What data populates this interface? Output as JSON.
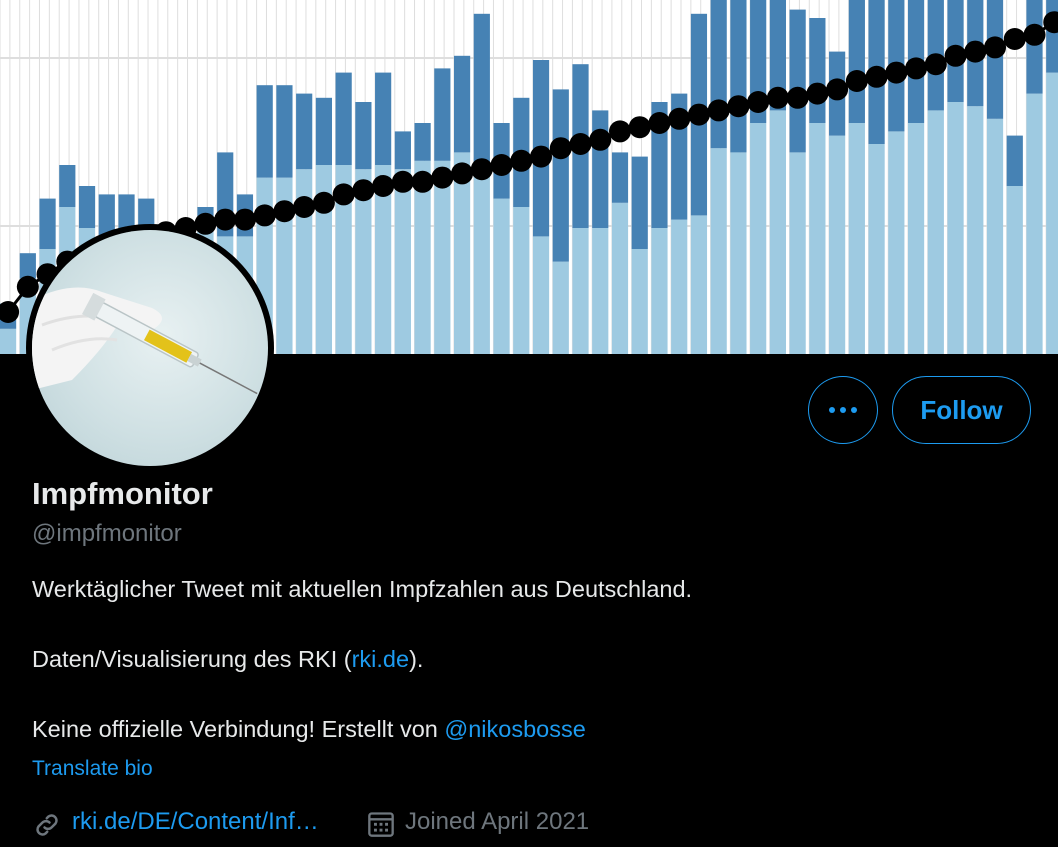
{
  "profile": {
    "name": "Impfmonitor",
    "handle": "@impfmonitor",
    "bio": {
      "line1": "Werktäglicher Tweet mit aktuellen Impfzahlen aus Deutschland.",
      "line2_prefix": "Daten/Visualisierung des RKI (",
      "line2_link": "rki.de",
      "line2_suffix": ").",
      "line3_prefix": "Keine offizielle Verbindung! Erstellt von ",
      "line3_mention": "@nikosbosse"
    },
    "translate_label": "Translate bio",
    "website": "rki.de/DE/Content/Inf…",
    "joined": "Joined April 2021"
  },
  "actions": {
    "more_icon": "more-horizontal-icon",
    "follow_label": "Follow"
  },
  "icons": {
    "link": "link-icon",
    "calendar": "calendar-icon"
  },
  "colors": {
    "accent": "#1d9bf0",
    "bar_dark": "#4682b4",
    "bar_light": "#9ecae1",
    "dots": "#000000",
    "background": "#000000"
  },
  "chart_data": {
    "type": "bar",
    "stacked": true,
    "grid": true,
    "series": [
      {
        "values": [
          6,
          18,
          25,
          35,
          30,
          28,
          29,
          25,
          14,
          22,
          30,
          28,
          28,
          42,
          42,
          44,
          45,
          45,
          44,
          45,
          44,
          46,
          46,
          48,
          45,
          37,
          35,
          28,
          22,
          30,
          30,
          36,
          25,
          30,
          32,
          33,
          49,
          48,
          55,
          58,
          48,
          55,
          52,
          55,
          50,
          53,
          55,
          58,
          60,
          59,
          56,
          40,
          62,
          67
        ]
      },
      {
        "values": [
          6,
          6,
          12,
          10,
          10,
          10,
          9,
          12,
          7,
          8,
          5,
          20,
          10,
          22,
          22,
          18,
          16,
          22,
          16,
          22,
          9,
          9,
          22,
          23,
          36,
          18,
          26,
          42,
          41,
          39,
          28,
          12,
          22,
          30,
          30,
          48,
          40,
          44,
          35,
          42,
          34,
          25,
          20,
          38,
          35,
          43,
          43,
          47,
          55,
          45,
          44,
          12,
          30,
          32
        ]
      }
    ],
    "dots": [
      10,
      16,
      19,
      22,
      23,
      25,
      26,
      27,
      29,
      30,
      31,
      32,
      32,
      33,
      34,
      35,
      36,
      38,
      39,
      40,
      41,
      41,
      42,
      43,
      44,
      45,
      46,
      47,
      49,
      50,
      51,
      53,
      54,
      55,
      56,
      57,
      58,
      59,
      60,
      61,
      61,
      62,
      63,
      65,
      66,
      67,
      68,
      69,
      71,
      72,
      73,
      75,
      76,
      79
    ]
  }
}
